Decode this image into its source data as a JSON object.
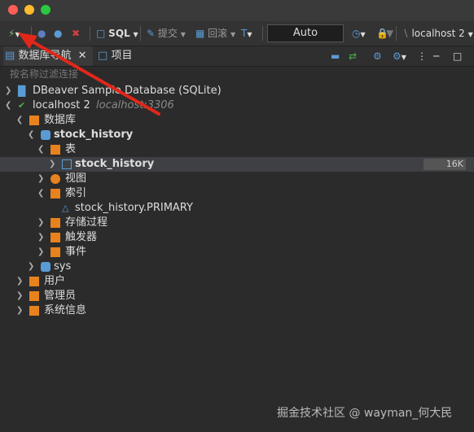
{
  "window": {
    "traffic_lights": [
      "#ff5f57",
      "#febc2e",
      "#28c840"
    ]
  },
  "toolbar": {
    "sql_label": "SQL",
    "commit_label": "提交",
    "rollback_label": "回滚",
    "mode_value": "Auto",
    "connection_label": "localhost 2"
  },
  "tabs": {
    "navigator": "数据库导航",
    "projects": "项目"
  },
  "filter": {
    "placeholder": "按名称过滤连接"
  },
  "tree": {
    "dbeaver_sample": "DBeaver Sample Database (SQLite)",
    "localhost": "localhost 2",
    "localhost_host": "localhost:3306",
    "databases": "数据库",
    "stock_history_db": "stock_history",
    "tables": "表",
    "stock_history_table": "stock_history",
    "table_size": "16K",
    "views": "视图",
    "indexes": "索引",
    "index_primary": "stock_history.PRIMARY",
    "procedures": "存储过程",
    "triggers": "触发器",
    "events": "事件",
    "sys": "sys",
    "users": "用户",
    "admins": "管理员",
    "sysinfo": "系统信息"
  },
  "watermark": "掘金技术社区 @ wayman_何大民",
  "colors": {
    "accent_red": "#e0271a",
    "folder": "#e8821e",
    "db": "#5b9bd5"
  }
}
